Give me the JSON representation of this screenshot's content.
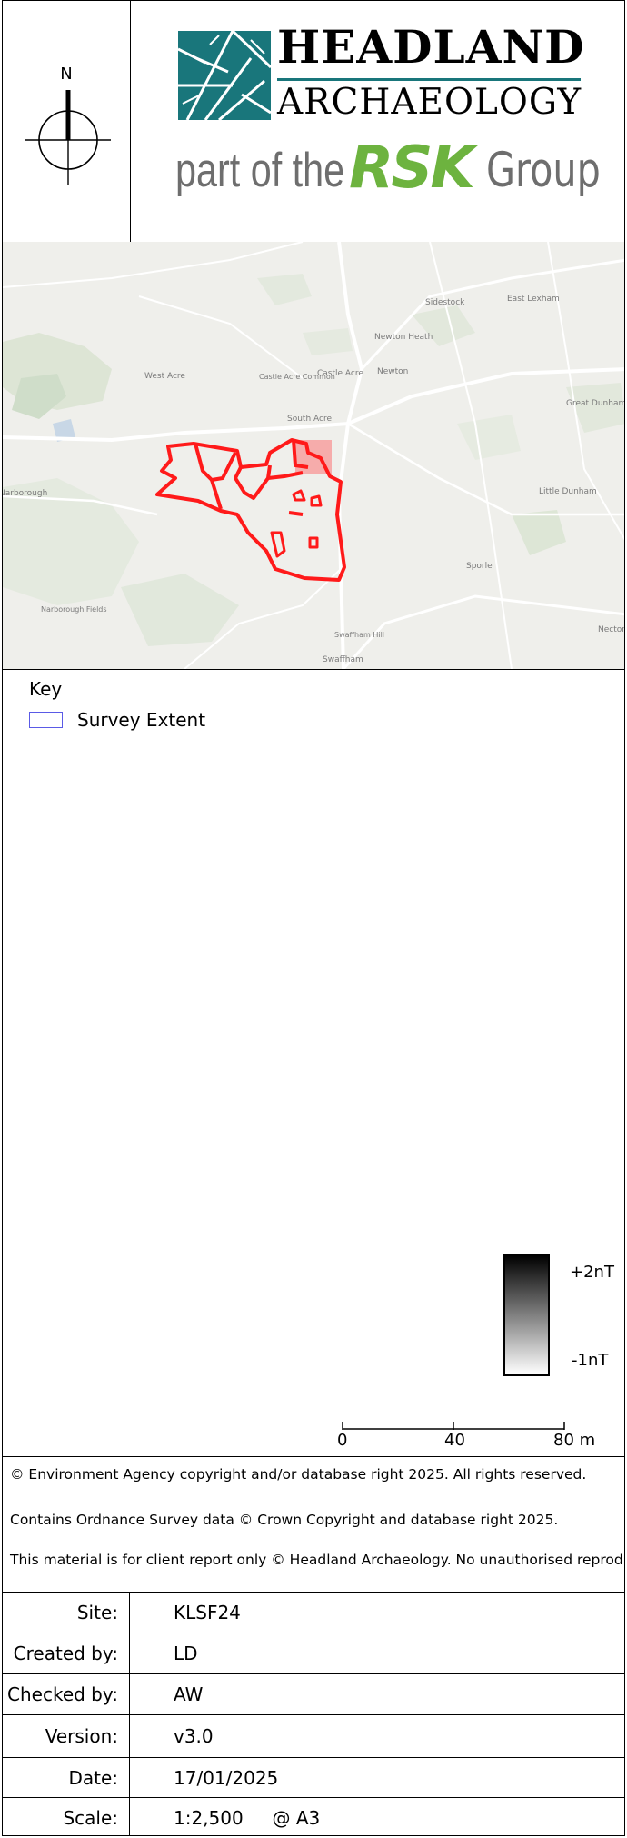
{
  "north_arrow": {
    "label": "N"
  },
  "logo": {
    "name_line1": "HEADLAND",
    "name_line2": "ARCHAEOLOGY",
    "tagline_prefix": "part of the",
    "tagline_brand": "RSK",
    "tagline_suffix": "Group",
    "brand_color": "#19767b",
    "rsk_color": "#6db33f"
  },
  "map": {
    "survey_outline_color": "#ff1a1a",
    "place_names": [
      "Sidestock",
      "East Lexham",
      "Newton Heath",
      "West Acre",
      "Castle Acre Common",
      "Castle Acre",
      "Newton",
      "Great Dunham",
      "South Acre",
      "Narborough",
      "Little Dunham",
      "Sporle",
      "Narborough Fields",
      "Swaffham Hill",
      "Swaffham",
      "Necton"
    ]
  },
  "key": {
    "title": "Key",
    "items": [
      {
        "label": "Survey Extent",
        "color": "#5a5ae6"
      }
    ]
  },
  "legend_ramp": {
    "max_label": "+2nT",
    "min_label": "-1nT"
  },
  "scale_bar": {
    "ticks": [
      "0",
      "40",
      "80 m"
    ]
  },
  "copyright": [
    "© Environment Agency copyright and/or database right 2025. All rights reserved.",
    "Contains Ordnance Survey data © Crown Copyright and database right 2025.",
    "This material is for client report only © Headland Archaeology. No unauthorised reproduction."
  ],
  "info_table": [
    {
      "label": "Site:",
      "value": "KLSF24"
    },
    {
      "label": "Created by:",
      "value": "LD"
    },
    {
      "label": "Checked by:",
      "value": "AW"
    },
    {
      "label": "Version:",
      "value": "v3.0"
    },
    {
      "label": "Date:",
      "value": "17/01/2025"
    },
    {
      "label": "Scale:",
      "value": "1:2,500     @ A3"
    }
  ]
}
